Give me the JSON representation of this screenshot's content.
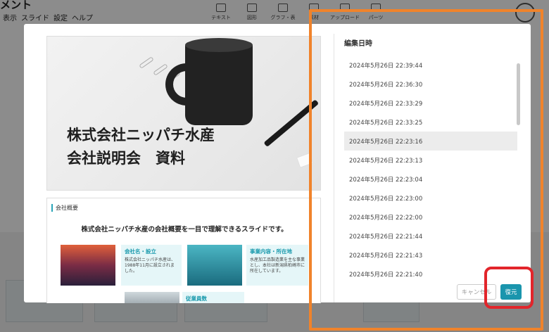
{
  "app": {
    "title": "メント",
    "menu": [
      "表示",
      "スライド",
      "設定",
      "ヘルプ"
    ],
    "toolbar": [
      "テキスト",
      "図形",
      "グラフ・表",
      "素材",
      "アップロード",
      "パーツ"
    ]
  },
  "preview": {
    "slide1": {
      "title": "株式会社ニッパチ水産\n会社説明会　資料"
    },
    "slide2": {
      "label": "会社概要",
      "subtitle": "株式会社ニッパチ水産の会社概要を一目で理解できるスライドです。",
      "cards": [
        {
          "title": "会社名・設立",
          "text": "株式会社ニッパチ水産は、1988年11月に設立されました。"
        },
        {
          "title": "事業内容・所在地",
          "text": "水産加工品製造業を主な事業とし、本社は新潟県柏崎市に所在しています。"
        },
        {
          "title": "従業員数",
          "text": ""
        }
      ]
    }
  },
  "history": {
    "title": "編集日時",
    "items": [
      "2024年5月26日 22:39:44",
      "2024年5月26日 22:36:30",
      "2024年5月26日 22:33:29",
      "2024年5月26日 22:33:25",
      "2024年5月26日 22:23:16",
      "2024年5月26日 22:23:13",
      "2024年5月26日 22:23:04",
      "2024年5月26日 22:23:00",
      "2024年5月26日 22:22:00",
      "2024年5月26日 22:21:44",
      "2024年5月26日 22:21:43",
      "2024年5月26日 22:21:40"
    ],
    "selected_index": 4
  },
  "buttons": {
    "cancel": "キャンセル",
    "restore": "復元"
  },
  "colors": {
    "accent": "#1a95ad",
    "annotation_orange": "#f0832b",
    "annotation_red": "#e2252b"
  }
}
